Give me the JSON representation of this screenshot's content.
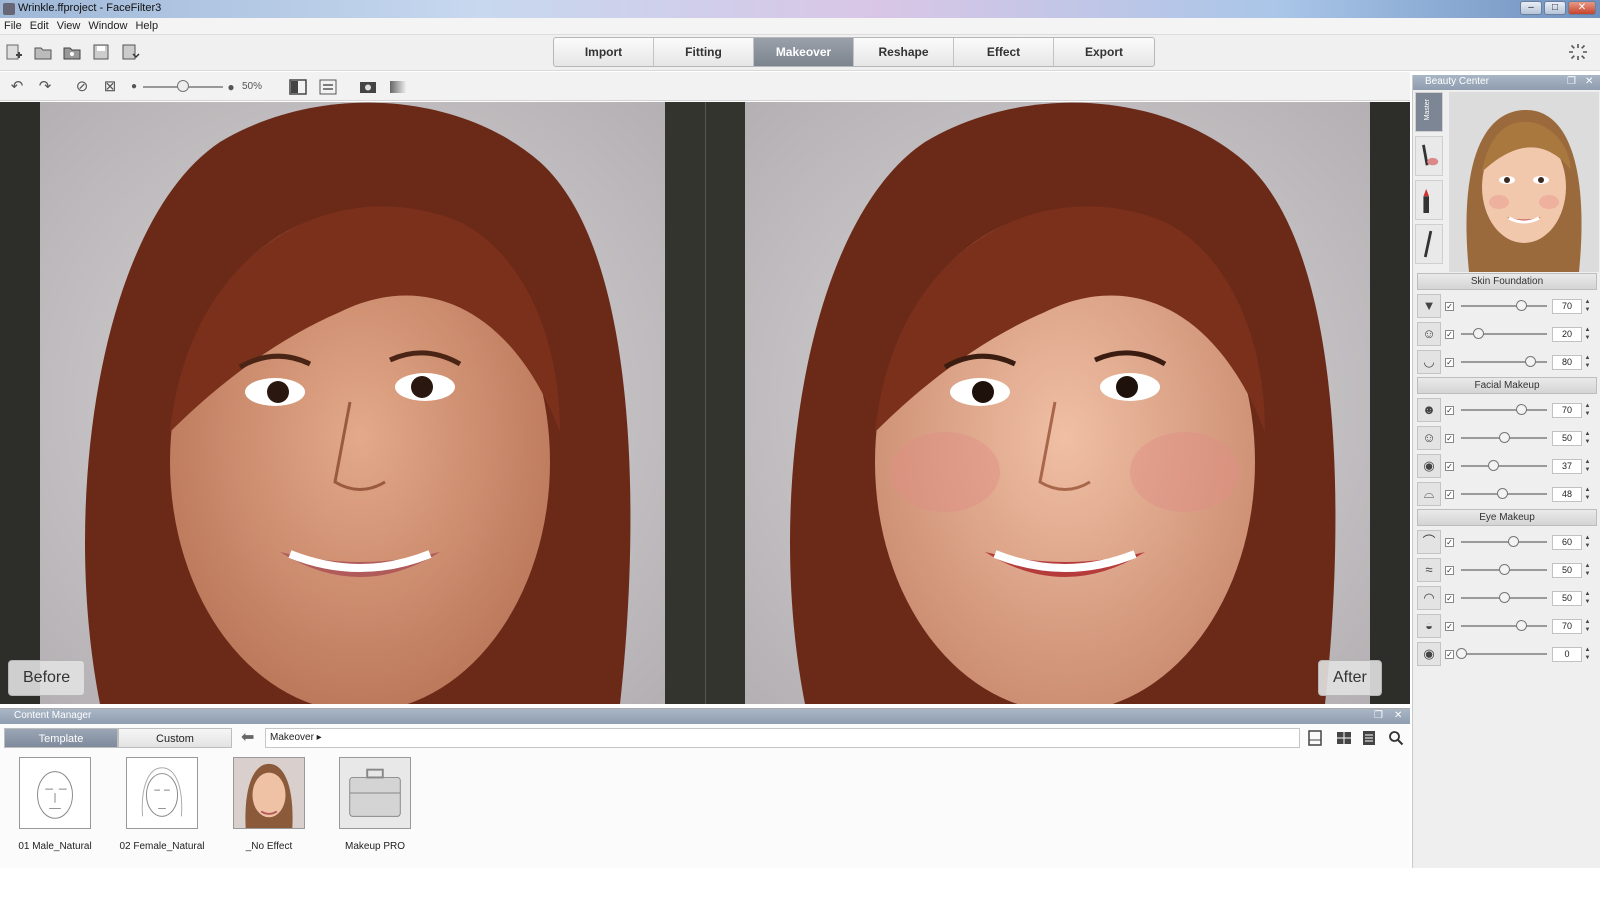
{
  "window": {
    "title": "Wrinkle.ffproject - FaceFilter3"
  },
  "menu": [
    "File",
    "Edit",
    "View",
    "Window",
    "Help"
  ],
  "toolbar": {
    "icons": [
      "new-project-icon",
      "open-icon",
      "open-folder-icon",
      "save-icon",
      "save-as-icon",
      "busy-spinner-icon"
    ],
    "steps": [
      {
        "label": "Import",
        "active": false
      },
      {
        "label": "Fitting",
        "active": false
      },
      {
        "label": "Makeover",
        "active": true
      },
      {
        "label": "Reshape",
        "active": false
      },
      {
        "label": "Effect",
        "active": false
      },
      {
        "label": "Export",
        "active": false
      }
    ]
  },
  "viewbar": {
    "zoom_label": "50%",
    "zoom_fraction": 0.5
  },
  "viewer": {
    "before_label": "Before",
    "after_label": "After"
  },
  "content_manager": {
    "title": "Content Manager",
    "tabs": [
      {
        "label": "Template",
        "active": true
      },
      {
        "label": "Custom",
        "active": false
      }
    ],
    "path": "Makeover ▸",
    "items": [
      {
        "label": "01 Male_Natural"
      },
      {
        "label": "02 Female_Natural"
      },
      {
        "label": "_No Effect"
      },
      {
        "label": "Makeup PRO"
      }
    ]
  },
  "beauty_center": {
    "title": "Beauty Center",
    "side_tab_label": "Master",
    "sections": [
      {
        "title": "Skin Foundation",
        "sliders": [
          {
            "icon": "foundation-icon",
            "value": "70"
          },
          {
            "icon": "blemish-icon",
            "value": "20"
          },
          {
            "icon": "face-shape-icon",
            "value": "80"
          }
        ]
      },
      {
        "title": "Facial Makeup",
        "sliders": [
          {
            "icon": "face-contour-icon",
            "value": "70"
          },
          {
            "icon": "blush-icon",
            "value": "50"
          },
          {
            "icon": "lip-gloss-icon",
            "value": "37"
          },
          {
            "icon": "lip-color-icon",
            "value": "48"
          }
        ]
      },
      {
        "title": "Eye Makeup",
        "sliders": [
          {
            "icon": "eyebrow-icon",
            "value": "60"
          },
          {
            "icon": "eyeliner-icon",
            "value": "50"
          },
          {
            "icon": "eye-shadow-icon",
            "value": "50"
          },
          {
            "icon": "eyelid-icon",
            "value": "70"
          },
          {
            "icon": "iris-icon",
            "value": "0"
          }
        ]
      }
    ]
  }
}
